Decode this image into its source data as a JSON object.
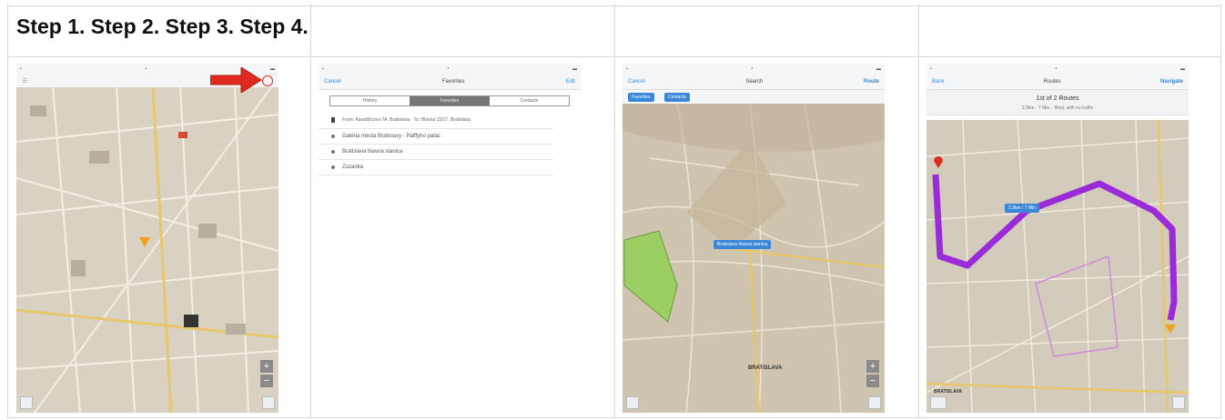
{
  "title": "Step 1. Step 2. Step 3. Step 4.",
  "colors": {
    "map_base": "#d9d2c3",
    "accent_blue": "#3a86d8",
    "route_purple": "#9b2bd8",
    "arrow_red": "#e0291f",
    "park_green": "#9ccf63"
  },
  "step2": {
    "nav_left": "Cancel",
    "nav_title": "Favorites",
    "nav_right": "Edit",
    "segments": [
      "History",
      "Favorites",
      "Contacts"
    ],
    "selected_segment": "Favorites",
    "first_row": "From: Karadžičova 7A, Bratislava · To: Hlavná 15/17, Bratislava",
    "rows": [
      "Galéria mesta Bratislavy - Pálffyho palác",
      "Bratislava hlavná stanica",
      "Zuzanka"
    ]
  },
  "step3": {
    "nav_left": "Cancel",
    "nav_title": "Search",
    "nav_right": "Route",
    "chips": [
      "Favorites",
      "Contacts"
    ],
    "pin_label": "Bratislava hlavná stanica",
    "map_label": "BRATISLAVA"
  },
  "step4": {
    "nav_left": "Back",
    "nav_title": "Routes",
    "nav_right": "Navigate",
    "route_count": "1st of 2 Routes",
    "route_info": "2.9km · 7 Min. · Best, with no traffic",
    "route_badge": "2.9km / 7 Min",
    "map_label": "BRATISLAVA"
  }
}
